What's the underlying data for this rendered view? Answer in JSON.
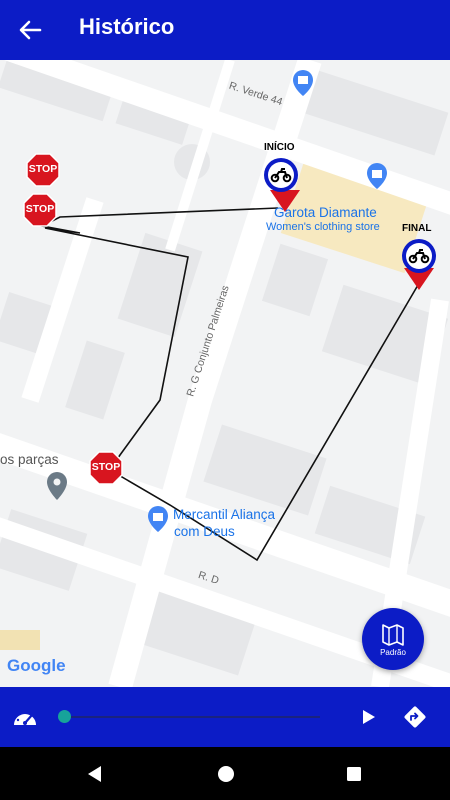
{
  "appbar": {
    "title": "Histórico",
    "back_icon": "arrow-back-icon"
  },
  "map": {
    "roads": [
      "R. Verde 44",
      "R. G Conjunto Palmeiras",
      "R. D"
    ],
    "pois": [
      {
        "name": "Garota Diamante",
        "category": "Women's clothing store"
      },
      {
        "name": "Mercantil Aliança",
        "line2": "com Deus"
      },
      {
        "name": "os parças"
      }
    ],
    "markers": {
      "start_label": "INÍCIO",
      "end_label": "FINAL",
      "stop_label": "STOP"
    },
    "attribution": "Google"
  },
  "fab": {
    "label": "Padrão",
    "icon": "map-icon"
  },
  "player": {
    "progress": 0,
    "icons": [
      "speedometer-icon",
      "play-icon",
      "directions-icon"
    ]
  },
  "nav": {
    "icons": [
      "back-triangle-icon",
      "home-circle-icon",
      "recents-square-icon"
    ]
  },
  "colors": {
    "primary": "#0c1cc6",
    "accent": "#17a39a",
    "stop": "#d8151f"
  }
}
